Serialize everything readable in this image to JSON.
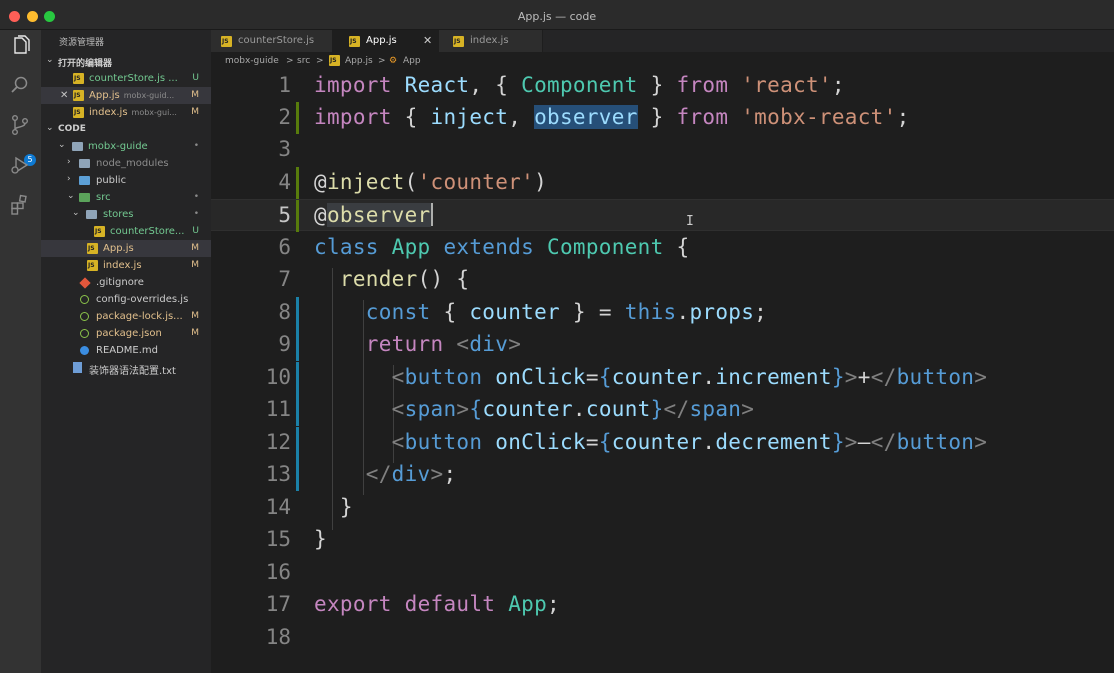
{
  "window": {
    "title": "App.js — code"
  },
  "activity_bar": {
    "icons": [
      "files-icon",
      "search-icon",
      "source-control-icon",
      "run-debug-icon",
      "extensions-icon"
    ],
    "scm_badge": "5"
  },
  "sidebar": {
    "title": "资源管理器",
    "open_editors": {
      "header": "打开的编辑器",
      "items": [
        {
          "name": "counterStore.js ...",
          "path": "",
          "status": "U"
        },
        {
          "name": "App.js",
          "path": "mobx-guid...",
          "status": "M",
          "close": "✕"
        },
        {
          "name": "index.js",
          "path": "mobx-gui...",
          "status": "M"
        }
      ]
    },
    "workspace": {
      "header": "CODE",
      "items": [
        {
          "name": "mobx-guide",
          "status": "•",
          "chevron": "⌄"
        },
        {
          "name": "node_modules",
          "status": "",
          "chevron": "›"
        },
        {
          "name": "public",
          "status": "",
          "chevron": "›"
        },
        {
          "name": "src",
          "status": "•",
          "chevron": "⌄"
        },
        {
          "name": "stores",
          "status": "•",
          "chevron": "⌄"
        },
        {
          "name": "counterStore...",
          "status": "U"
        },
        {
          "name": "App.js",
          "status": "M"
        },
        {
          "name": "index.js",
          "status": "M"
        },
        {
          "name": ".gitignore",
          "status": ""
        },
        {
          "name": "config-overrides.js",
          "status": ""
        },
        {
          "name": "package-lock.js...",
          "status": "M"
        },
        {
          "name": "package.json",
          "status": "M"
        },
        {
          "name": "README.md",
          "status": ""
        },
        {
          "name": "装饰器语法配置.txt",
          "status": ""
        }
      ]
    }
  },
  "tabs": [
    {
      "label": "counterStore.js",
      "active": false
    },
    {
      "label": "App.js",
      "active": true,
      "close": "✕"
    },
    {
      "label": "index.js",
      "active": false
    }
  ],
  "breadcrumb": {
    "parts": [
      "mobx-guide",
      ">",
      "src",
      ">",
      "App.js",
      ">",
      "App"
    ],
    "symbol_icon": "class-symbol-icon"
  },
  "editor": {
    "current_line": 5,
    "line_numbers": [
      "1",
      "2",
      "3",
      "4",
      "5",
      "6",
      "7",
      "8",
      "9",
      "10",
      "11",
      "12",
      "13",
      "14",
      "15",
      "16",
      "17",
      "18"
    ],
    "tokens": {
      "l1": [
        "import",
        " ",
        "React",
        ", ",
        "{",
        " ",
        "Component",
        " ",
        "}",
        " ",
        "from",
        " ",
        "'react'",
        ";"
      ],
      "l2": [
        "import",
        " ",
        "{",
        " ",
        "inject",
        ", ",
        "observer",
        " ",
        "}",
        " ",
        "from",
        " ",
        "'mobx-react'",
        ";"
      ],
      "l4": [
        "@",
        "inject",
        "(",
        "'counter'",
        ")"
      ],
      "l5": [
        "@",
        "observer"
      ],
      "l6": [
        "class",
        " ",
        "App",
        " ",
        "extends",
        " ",
        "Component",
        " ",
        "{"
      ],
      "l7": [
        "  ",
        "render",
        "()",
        " ",
        "{"
      ],
      "l8": [
        "    ",
        "const",
        " ",
        "{",
        " ",
        "counter",
        " ",
        "}",
        " = ",
        "this",
        ".",
        "props",
        ";"
      ],
      "l9": [
        "    ",
        "return",
        " ",
        "<",
        "div",
        ">"
      ],
      "l10": [
        "      ",
        "<",
        "button",
        " ",
        "onClick",
        "=",
        "{",
        "counter",
        ".",
        "increment",
        "}",
        ">",
        "+",
        "</",
        "button",
        ">"
      ],
      "l11": [
        "      ",
        "<",
        "span",
        ">",
        "{",
        "counter",
        ".",
        "count",
        "}",
        "</",
        "span",
        ">"
      ],
      "l12": [
        "      ",
        "<",
        "button",
        " ",
        "onClick",
        "=",
        "{",
        "counter",
        ".",
        "decrement",
        "}",
        ">",
        "–",
        "</",
        "button",
        ">"
      ],
      "l13": [
        "    ",
        "</",
        "div",
        ">",
        ";"
      ],
      "l14": [
        "  ",
        "}"
      ],
      "l15": [
        "}"
      ],
      "l17": [
        "export",
        " ",
        "default",
        " ",
        "App",
        ";"
      ]
    }
  },
  "colors": {
    "keyword": "#c586c0",
    "storage": "#569cd6",
    "class": "#4ec9b0",
    "variable": "#9cdcfe",
    "function": "#dcdcaa",
    "string": "#ce9178",
    "gutter_modified": "#1b81a8",
    "gutter_added": "#587c0c",
    "status_untracked": "#73c991",
    "status_modified": "#e2c08d"
  }
}
